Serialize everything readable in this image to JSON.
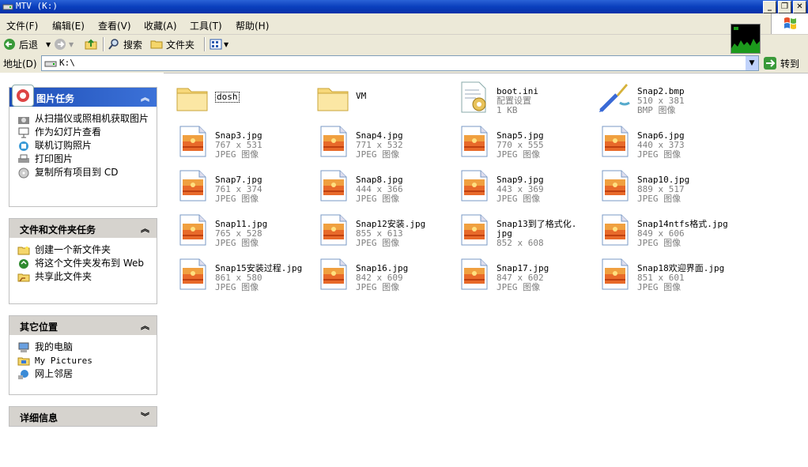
{
  "window": {
    "title": "MTV (K:)"
  },
  "menu": {
    "items": [
      "文件(F)",
      "编辑(E)",
      "查看(V)",
      "收藏(A)",
      "工具(T)",
      "帮助(H)"
    ]
  },
  "toolbar": {
    "back_label": "后退",
    "search_label": "搜索",
    "folders_label": "文件夹"
  },
  "address": {
    "label": "地址(D)",
    "value": "K:\\",
    "go_label": "转到"
  },
  "sidebar": {
    "picture_tasks": {
      "title": "图片任务",
      "items": [
        "从扫描仪或照相机获取图片",
        "作为幻灯片查看",
        "联机订购照片",
        "打印图片",
        "复制所有项目到 CD"
      ]
    },
    "file_tasks": {
      "title": "文件和文件夹任务",
      "items": [
        "创建一个新文件夹",
        "将这个文件夹发布到 Web",
        "共享此文件夹"
      ]
    },
    "other_places": {
      "title": "其它位置",
      "items": [
        "我的电脑",
        "My Pictures",
        "网上邻居"
      ]
    },
    "details": {
      "title": "详细信息"
    },
    "chevron_up": "⌃",
    "chevron_down": "⌄"
  },
  "files": [
    {
      "name": "dosh",
      "line2": "",
      "line3": "",
      "kind": "folder"
    },
    {
      "name": "VM",
      "line2": "",
      "line3": "",
      "kind": "folder"
    },
    {
      "name": "boot.ini",
      "line2": "配置设置",
      "line3": "1 KB",
      "kind": "ini"
    },
    {
      "name": "Snap2.bmp",
      "line2": "510 x 381",
      "line3": "BMP 图像",
      "kind": "bmp"
    },
    {
      "name": "Snap3.jpg",
      "line2": "767 x 531",
      "line3": "JPEG 图像",
      "kind": "jpg"
    },
    {
      "name": "Snap4.jpg",
      "line2": "771 x 532",
      "line3": "JPEG 图像",
      "kind": "jpg"
    },
    {
      "name": "Snap5.jpg",
      "line2": "770 x 555",
      "line3": "JPEG 图像",
      "kind": "jpg"
    },
    {
      "name": "Snap6.jpg",
      "line2": "440 x 373",
      "line3": "JPEG 图像",
      "kind": "jpg"
    },
    {
      "name": "Snap7.jpg",
      "line2": "761 x 374",
      "line3": "JPEG 图像",
      "kind": "jpg"
    },
    {
      "name": "Snap8.jpg",
      "line2": "444 x 366",
      "line3": "JPEG 图像",
      "kind": "jpg"
    },
    {
      "name": "Snap9.jpg",
      "line2": "443 x 369",
      "line3": "JPEG 图像",
      "kind": "jpg"
    },
    {
      "name": "Snap10.jpg",
      "line2": "889 x 517",
      "line3": "JPEG 图像",
      "kind": "jpg"
    },
    {
      "name": "Snap11.jpg",
      "line2": "765 x 528",
      "line3": "JPEG 图像",
      "kind": "jpg"
    },
    {
      "name": "Snap12安装.jpg",
      "line2": "855 x 613",
      "line3": "JPEG 图像",
      "kind": "jpg"
    },
    {
      "name": "Snap13到了格式化.",
      "line2": "jpg",
      "line3": "852 x 608",
      "kind": "jpg"
    },
    {
      "name": "Snap14ntfs格式.jpg",
      "line2": "849 x 606",
      "line3": "JPEG 图像",
      "kind": "jpg"
    },
    {
      "name": "Snap15安装过程.jpg",
      "line2": "861 x 580",
      "line3": "JPEG 图像",
      "kind": "jpg"
    },
    {
      "name": "Snap16.jpg",
      "line2": "842 x 609",
      "line3": "JPEG 图像",
      "kind": "jpg"
    },
    {
      "name": "Snap17.jpg",
      "line2": "847 x 602",
      "line3": "JPEG 图像",
      "kind": "jpg"
    },
    {
      "name": "Snap18欢迎界面.jpg",
      "line2": "851 x 601",
      "line3": "JPEG 图像",
      "kind": "jpg"
    }
  ]
}
